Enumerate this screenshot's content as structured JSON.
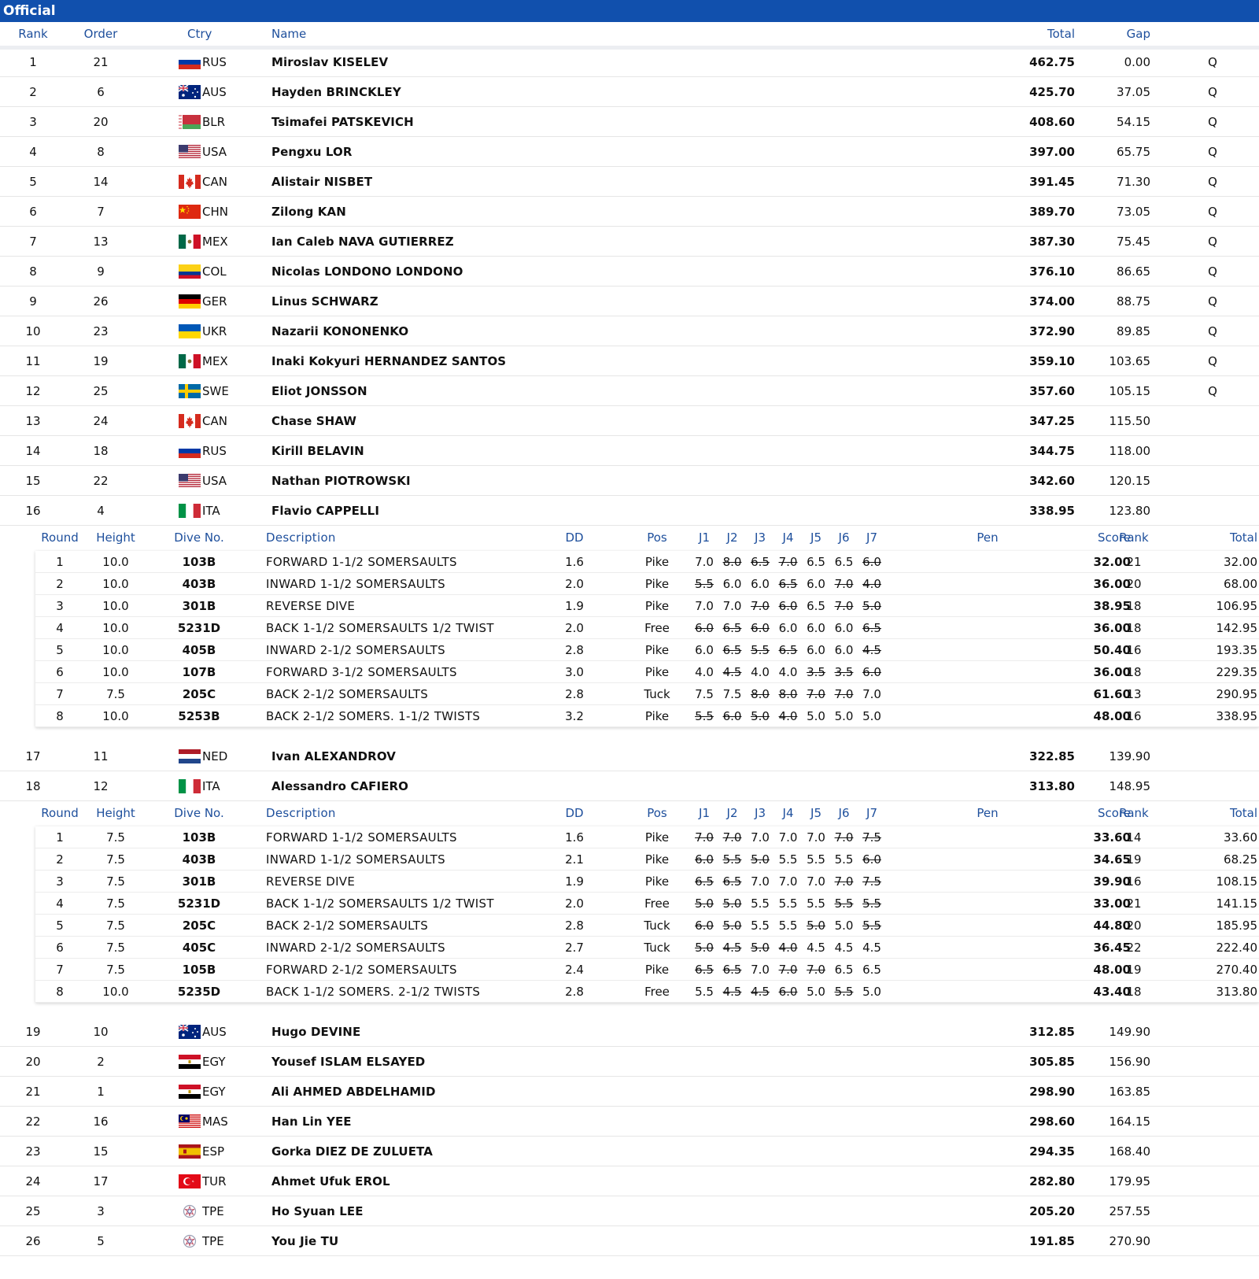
{
  "page": {
    "status_label": "Official"
  },
  "headers": {
    "rank": "Rank",
    "order": "Order",
    "ctry": "Ctry",
    "name": "Name",
    "total": "Total",
    "gap": "Gap"
  },
  "sub_headers": {
    "round": "Round",
    "height": "Height",
    "dive": "Dive No.",
    "desc": "Description",
    "dd": "DD",
    "pos": "Pos",
    "j1": "J1",
    "j2": "J2",
    "j3": "J3",
    "j4": "J4",
    "j5": "J5",
    "j6": "J6",
    "j7": "J7",
    "pen": "Pen",
    "score": "Score",
    "rank": "Rank",
    "total": "Total"
  },
  "flag_colors": {
    "red": "#d52b1e",
    "blue": "#1f3b8a",
    "white": "#ffffff",
    "gold": "#f2c500",
    "green": "#1c8a3d"
  },
  "results": [
    {
      "rank": "1",
      "order": "21",
      "ctry": "RUS",
      "flag": "flag-rus-icon",
      "name": "Miroslav KISELEV",
      "total": "462.75",
      "gap": "0.00",
      "q": "Q"
    },
    {
      "rank": "2",
      "order": "6",
      "ctry": "AUS",
      "flag": "flag-aus-icon",
      "name": "Hayden BRINCKLEY",
      "total": "425.70",
      "gap": "37.05",
      "q": "Q"
    },
    {
      "rank": "3",
      "order": "20",
      "ctry": "BLR",
      "flag": "flag-blr-icon",
      "name": "Tsimafei PATSKEVICH",
      "total": "408.60",
      "gap": "54.15",
      "q": "Q"
    },
    {
      "rank": "4",
      "order": "8",
      "ctry": "USA",
      "flag": "flag-usa-icon",
      "name": "Pengxu LOR",
      "total": "397.00",
      "gap": "65.75",
      "q": "Q"
    },
    {
      "rank": "5",
      "order": "14",
      "ctry": "CAN",
      "flag": "flag-can-icon",
      "name": "Alistair NISBET",
      "total": "391.45",
      "gap": "71.30",
      "q": "Q"
    },
    {
      "rank": "6",
      "order": "7",
      "ctry": "CHN",
      "flag": "flag-chn-icon",
      "name": "Zilong KAN",
      "total": "389.70",
      "gap": "73.05",
      "q": "Q"
    },
    {
      "rank": "7",
      "order": "13",
      "ctry": "MEX",
      "flag": "flag-mex-icon",
      "name": "Ian Caleb NAVA GUTIERREZ",
      "total": "387.30",
      "gap": "75.45",
      "q": "Q"
    },
    {
      "rank": "8",
      "order": "9",
      "ctry": "COL",
      "flag": "flag-col-icon",
      "name": "Nicolas LONDONO LONDONO",
      "total": "376.10",
      "gap": "86.65",
      "q": "Q"
    },
    {
      "rank": "9",
      "order": "26",
      "ctry": "GER",
      "flag": "flag-ger-icon",
      "name": "Linus SCHWARZ",
      "total": "374.00",
      "gap": "88.75",
      "q": "Q"
    },
    {
      "rank": "10",
      "order": "23",
      "ctry": "UKR",
      "flag": "flag-ukr-icon",
      "name": "Nazarii KONONENKO",
      "total": "372.90",
      "gap": "89.85",
      "q": "Q"
    },
    {
      "rank": "11",
      "order": "19",
      "ctry": "MEX",
      "flag": "flag-mex-icon",
      "name": "Inaki Kokyuri HERNANDEZ SANTOS",
      "total": "359.10",
      "gap": "103.65",
      "q": "Q"
    },
    {
      "rank": "12",
      "order": "25",
      "ctry": "SWE",
      "flag": "flag-swe-icon",
      "name": "Eliot JONSSON",
      "total": "357.60",
      "gap": "105.15",
      "q": "Q"
    },
    {
      "rank": "13",
      "order": "24",
      "ctry": "CAN",
      "flag": "flag-can-icon",
      "name": "Chase SHAW",
      "total": "347.25",
      "gap": "115.50",
      "q": ""
    },
    {
      "rank": "14",
      "order": "18",
      "ctry": "RUS",
      "flag": "flag-rus-icon",
      "name": "Kirill BELAVIN",
      "total": "344.75",
      "gap": "118.00",
      "q": ""
    },
    {
      "rank": "15",
      "order": "22",
      "ctry": "USA",
      "flag": "flag-usa-icon",
      "name": "Nathan PIOTROWSKI",
      "total": "342.60",
      "gap": "120.15",
      "q": ""
    },
    {
      "rank": "16",
      "order": "4",
      "ctry": "ITA",
      "flag": "flag-ita-icon",
      "name": "Flavio CAPPELLI",
      "total": "338.95",
      "gap": "123.80",
      "q": ""
    },
    {
      "rank": "17",
      "order": "11",
      "ctry": "NED",
      "flag": "flag-ned-icon",
      "name": "Ivan ALEXANDROV",
      "total": "322.85",
      "gap": "139.90",
      "q": ""
    },
    {
      "rank": "18",
      "order": "12",
      "ctry": "ITA",
      "flag": "flag-ita-icon",
      "name": "Alessandro CAFIERO",
      "total": "313.80",
      "gap": "148.95",
      "q": ""
    },
    {
      "rank": "19",
      "order": "10",
      "ctry": "AUS",
      "flag": "flag-aus-icon",
      "name": "Hugo DEVINE",
      "total": "312.85",
      "gap": "149.90",
      "q": ""
    },
    {
      "rank": "20",
      "order": "2",
      "ctry": "EGY",
      "flag": "flag-egy-icon",
      "name": "Yousef ISLAM ELSAYED",
      "total": "305.85",
      "gap": "156.90",
      "q": ""
    },
    {
      "rank": "21",
      "order": "1",
      "ctry": "EGY",
      "flag": "flag-egy-icon",
      "name": "Ali AHMED ABDELHAMID",
      "total": "298.90",
      "gap": "163.85",
      "q": ""
    },
    {
      "rank": "22",
      "order": "16",
      "ctry": "MAS",
      "flag": "flag-mas-icon",
      "name": "Han Lin YEE",
      "total": "298.60",
      "gap": "164.15",
      "q": ""
    },
    {
      "rank": "23",
      "order": "15",
      "ctry": "ESP",
      "flag": "flag-esp-icon",
      "name": "Gorka DIEZ DE ZULUETA",
      "total": "294.35",
      "gap": "168.40",
      "q": ""
    },
    {
      "rank": "24",
      "order": "17",
      "ctry": "TUR",
      "flag": "flag-tur-icon",
      "name": "Ahmet Ufuk EROL",
      "total": "282.80",
      "gap": "179.95",
      "q": ""
    },
    {
      "rank": "25",
      "order": "3",
      "ctry": "TPE",
      "flag": "flag-tpe-icon",
      "name": "Ho Syuan LEE",
      "total": "205.20",
      "gap": "257.55",
      "q": ""
    },
    {
      "rank": "26",
      "order": "5",
      "ctry": "TPE",
      "flag": "flag-tpe-icon",
      "name": "You Jie TU",
      "total": "191.85",
      "gap": "270.90",
      "q": ""
    }
  ],
  "dive_details": {
    "16": [
      {
        "round": "1",
        "height": "10.0",
        "dive": "103B",
        "desc": "FORWARD 1-1/2 SOMERSAULTS",
        "dd": "1.6",
        "pos": "Pike",
        "judges": [
          [
            "7.0",
            false
          ],
          [
            "8.0",
            true
          ],
          [
            "6.5",
            true
          ],
          [
            "7.0",
            true
          ],
          [
            "6.5",
            false
          ],
          [
            "6.5",
            false
          ],
          [
            "6.0",
            true
          ]
        ],
        "score": "32.00",
        "rank": "21",
        "total": "32.00"
      },
      {
        "round": "2",
        "height": "10.0",
        "dive": "403B",
        "desc": "INWARD 1-1/2 SOMERSAULTS",
        "dd": "2.0",
        "pos": "Pike",
        "judges": [
          [
            "5.5",
            true
          ],
          [
            "6.0",
            false
          ],
          [
            "6.0",
            false
          ],
          [
            "6.5",
            true
          ],
          [
            "6.0",
            false
          ],
          [
            "7.0",
            true
          ],
          [
            "4.0",
            true
          ]
        ],
        "score": "36.00",
        "rank": "20",
        "total": "68.00"
      },
      {
        "round": "3",
        "height": "10.0",
        "dive": "301B",
        "desc": "REVERSE DIVE",
        "dd": "1.9",
        "pos": "Pike",
        "judges": [
          [
            "7.0",
            false
          ],
          [
            "7.0",
            false
          ],
          [
            "7.0",
            true
          ],
          [
            "6.0",
            true
          ],
          [
            "6.5",
            false
          ],
          [
            "7.0",
            true
          ],
          [
            "5.0",
            true
          ]
        ],
        "score": "38.95",
        "rank": "18",
        "total": "106.95"
      },
      {
        "round": "4",
        "height": "10.0",
        "dive": "5231D",
        "desc": "BACK 1-1/2 SOMERSAULTS 1/2 TWIST",
        "dd": "2.0",
        "pos": "Free",
        "judges": [
          [
            "6.0",
            true
          ],
          [
            "6.5",
            true
          ],
          [
            "6.0",
            true
          ],
          [
            "6.0",
            false
          ],
          [
            "6.0",
            false
          ],
          [
            "6.0",
            false
          ],
          [
            "6.5",
            true
          ]
        ],
        "score": "36.00",
        "rank": "18",
        "total": "142.95"
      },
      {
        "round": "5",
        "height": "10.0",
        "dive": "405B",
        "desc": "INWARD 2-1/2 SOMERSAULTS",
        "dd": "2.8",
        "pos": "Pike",
        "judges": [
          [
            "6.0",
            false
          ],
          [
            "6.5",
            true
          ],
          [
            "5.5",
            true
          ],
          [
            "6.5",
            true
          ],
          [
            "6.0",
            false
          ],
          [
            "6.0",
            false
          ],
          [
            "4.5",
            true
          ]
        ],
        "score": "50.40",
        "rank": "16",
        "total": "193.35"
      },
      {
        "round": "6",
        "height": "10.0",
        "dive": "107B",
        "desc": "FORWARD 3-1/2 SOMERSAULTS",
        "dd": "3.0",
        "pos": "Pike",
        "judges": [
          [
            "4.0",
            false
          ],
          [
            "4.5",
            true
          ],
          [
            "4.0",
            false
          ],
          [
            "4.0",
            false
          ],
          [
            "3.5",
            true
          ],
          [
            "3.5",
            true
          ],
          [
            "6.0",
            true
          ]
        ],
        "score": "36.00",
        "rank": "18",
        "total": "229.35"
      },
      {
        "round": "7",
        "height": "7.5",
        "dive": "205C",
        "desc": "BACK 2-1/2 SOMERSAULTS",
        "dd": "2.8",
        "pos": "Tuck",
        "judges": [
          [
            "7.5",
            false
          ],
          [
            "7.5",
            false
          ],
          [
            "8.0",
            true
          ],
          [
            "8.0",
            true
          ],
          [
            "7.0",
            true
          ],
          [
            "7.0",
            true
          ],
          [
            "7.0",
            false
          ]
        ],
        "score": "61.60",
        "rank": "13",
        "total": "290.95"
      },
      {
        "round": "8",
        "height": "10.0",
        "dive": "5253B",
        "desc": "BACK 2-1/2 SOMERS. 1-1/2 TWISTS",
        "dd": "3.2",
        "pos": "Pike",
        "judges": [
          [
            "5.5",
            true
          ],
          [
            "6.0",
            true
          ],
          [
            "5.0",
            true
          ],
          [
            "4.0",
            true
          ],
          [
            "5.0",
            false
          ],
          [
            "5.0",
            false
          ],
          [
            "5.0",
            false
          ]
        ],
        "score": "48.00",
        "rank": "16",
        "total": "338.95"
      }
    ],
    "18": [
      {
        "round": "1",
        "height": "7.5",
        "dive": "103B",
        "desc": "FORWARD 1-1/2 SOMERSAULTS",
        "dd": "1.6",
        "pos": "Pike",
        "judges": [
          [
            "7.0",
            true
          ],
          [
            "7.0",
            true
          ],
          [
            "7.0",
            false
          ],
          [
            "7.0",
            false
          ],
          [
            "7.0",
            false
          ],
          [
            "7.0",
            true
          ],
          [
            "7.5",
            true
          ]
        ],
        "score": "33.60",
        "rank": "14",
        "total": "33.60"
      },
      {
        "round": "2",
        "height": "7.5",
        "dive": "403B",
        "desc": "INWARD 1-1/2 SOMERSAULTS",
        "dd": "2.1",
        "pos": "Pike",
        "judges": [
          [
            "6.0",
            true
          ],
          [
            "5.5",
            true
          ],
          [
            "5.0",
            true
          ],
          [
            "5.5",
            false
          ],
          [
            "5.5",
            false
          ],
          [
            "5.5",
            false
          ],
          [
            "6.0",
            true
          ]
        ],
        "score": "34.65",
        "rank": "19",
        "total": "68.25"
      },
      {
        "round": "3",
        "height": "7.5",
        "dive": "301B",
        "desc": "REVERSE DIVE",
        "dd": "1.9",
        "pos": "Pike",
        "judges": [
          [
            "6.5",
            true
          ],
          [
            "6.5",
            true
          ],
          [
            "7.0",
            false
          ],
          [
            "7.0",
            false
          ],
          [
            "7.0",
            false
          ],
          [
            "7.0",
            true
          ],
          [
            "7.5",
            true
          ]
        ],
        "score": "39.90",
        "rank": "16",
        "total": "108.15"
      },
      {
        "round": "4",
        "height": "7.5",
        "dive": "5231D",
        "desc": "BACK 1-1/2 SOMERSAULTS 1/2 TWIST",
        "dd": "2.0",
        "pos": "Free",
        "judges": [
          [
            "5.0",
            true
          ],
          [
            "5.0",
            true
          ],
          [
            "5.5",
            false
          ],
          [
            "5.5",
            false
          ],
          [
            "5.5",
            false
          ],
          [
            "5.5",
            true
          ],
          [
            "5.5",
            true
          ]
        ],
        "score": "33.00",
        "rank": "21",
        "total": "141.15"
      },
      {
        "round": "5",
        "height": "7.5",
        "dive": "205C",
        "desc": "BACK 2-1/2 SOMERSAULTS",
        "dd": "2.8",
        "pos": "Tuck",
        "judges": [
          [
            "6.0",
            true
          ],
          [
            "5.0",
            true
          ],
          [
            "5.5",
            false
          ],
          [
            "5.5",
            false
          ],
          [
            "5.0",
            true
          ],
          [
            "5.0",
            false
          ],
          [
            "5.5",
            true
          ]
        ],
        "score": "44.80",
        "rank": "20",
        "total": "185.95"
      },
      {
        "round": "6",
        "height": "7.5",
        "dive": "405C",
        "desc": "INWARD 2-1/2 SOMERSAULTS",
        "dd": "2.7",
        "pos": "Tuck",
        "judges": [
          [
            "5.0",
            true
          ],
          [
            "4.5",
            true
          ],
          [
            "5.0",
            true
          ],
          [
            "4.0",
            true
          ],
          [
            "4.5",
            false
          ],
          [
            "4.5",
            false
          ],
          [
            "4.5",
            false
          ]
        ],
        "score": "36.45",
        "rank": "22",
        "total": "222.40"
      },
      {
        "round": "7",
        "height": "7.5",
        "dive": "105B",
        "desc": "FORWARD 2-1/2 SOMERSAULTS",
        "dd": "2.4",
        "pos": "Pike",
        "judges": [
          [
            "6.5",
            true
          ],
          [
            "6.5",
            true
          ],
          [
            "7.0",
            false
          ],
          [
            "7.0",
            true
          ],
          [
            "7.0",
            true
          ],
          [
            "6.5",
            false
          ],
          [
            "6.5",
            false
          ]
        ],
        "score": "48.00",
        "rank": "19",
        "total": "270.40"
      },
      {
        "round": "8",
        "height": "10.0",
        "dive": "5235D",
        "desc": "BACK 1-1/2 SOMERS. 2-1/2 TWISTS",
        "dd": "2.8",
        "pos": "Free",
        "judges": [
          [
            "5.5",
            false
          ],
          [
            "4.5",
            true
          ],
          [
            "4.5",
            true
          ],
          [
            "6.0",
            true
          ],
          [
            "5.0",
            false
          ],
          [
            "5.5",
            true
          ],
          [
            "5.0",
            false
          ]
        ],
        "score": "43.40",
        "rank": "18",
        "total": "313.80"
      }
    ]
  }
}
